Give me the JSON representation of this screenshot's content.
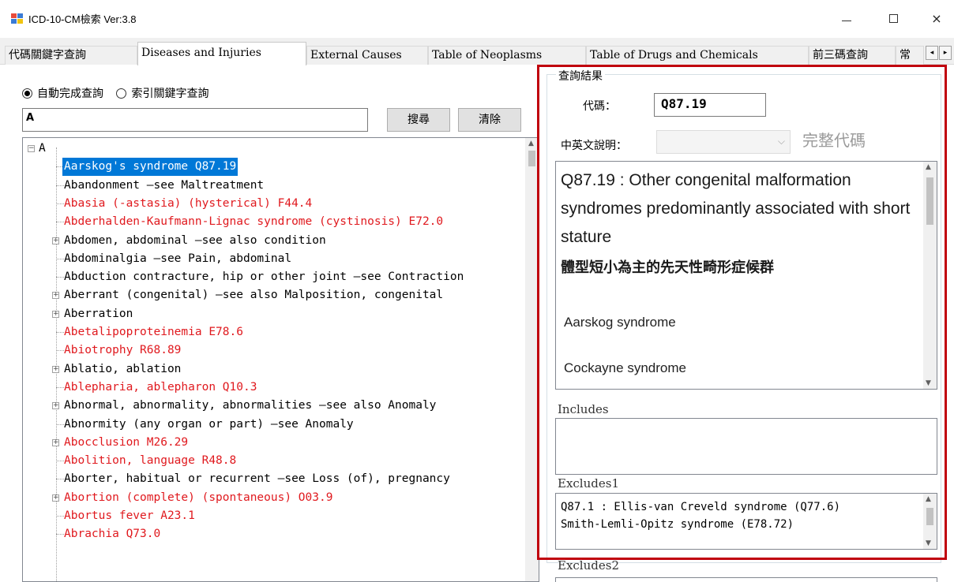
{
  "window": {
    "title": "ICD-10-CM檢索  Ver:3.8",
    "icon": "app-grid-icon",
    "controls": {
      "minimize": "minimize-icon",
      "maximize": "maximize-icon",
      "close": "×"
    }
  },
  "tabs": [
    {
      "label": "代碼關鍵字查詢",
      "active": false
    },
    {
      "label": "Diseases and Injuries",
      "active": true
    },
    {
      "label": "External Causes",
      "active": false
    },
    {
      "label": "Table of Neoplasms",
      "active": false
    },
    {
      "label": "Table of Drugs and Chemicals",
      "active": false
    },
    {
      "label": "前三碼查詢",
      "active": false
    },
    {
      "label": "常",
      "active": false
    }
  ],
  "tab_scroll": {
    "left": "◂",
    "right": "▸"
  },
  "search": {
    "mode_autocomplete": "自動完成查詢",
    "mode_index": "索引關鍵字查詢",
    "selected_mode": "autocomplete",
    "value": "A",
    "search_button": "搜尋",
    "clear_button": "清除"
  },
  "tree": {
    "root": "A",
    "items": [
      {
        "text": "Aarskog's syndrome  Q87.19",
        "color": "selected",
        "expandable": false
      },
      {
        "text": "Abandonment  —see Maltreatment",
        "color": "black",
        "expandable": false
      },
      {
        "text": "Abasia (-astasia) (hysterical) F44.4",
        "color": "red",
        "expandable": false
      },
      {
        "text": "Abderhalden-Kaufmann-Lignac syndrome (cystinosis) E72.0",
        "color": "red",
        "expandable": false
      },
      {
        "text": "Abdomen, abdominal  —see also condition",
        "color": "black",
        "expandable": true
      },
      {
        "text": "Abdominalgia  —see Pain, abdominal",
        "color": "black",
        "expandable": false
      },
      {
        "text": "Abduction contracture, hip or other joint  —see Contraction",
        "color": "black",
        "expandable": false
      },
      {
        "text": "Aberrant (congenital) —see also Malposition, congenital",
        "color": "black",
        "expandable": true
      },
      {
        "text": "Aberration",
        "color": "black",
        "expandable": true
      },
      {
        "text": "Abetalipoproteinemia  E78.6",
        "color": "red",
        "expandable": false
      },
      {
        "text": "Abiotrophy  R68.89",
        "color": "red",
        "expandable": false
      },
      {
        "text": "Ablatio, ablation",
        "color": "black",
        "expandable": true
      },
      {
        "text": "Ablepharia, ablepharon  Q10.3",
        "color": "red",
        "expandable": false
      },
      {
        "text": "Abnormal, abnormality, abnormalities  —see also Anomaly",
        "color": "black",
        "expandable": true
      },
      {
        "text": "Abnormity (any organ or part) —see Anomaly",
        "color": "black",
        "expandable": false
      },
      {
        "text": "Abocclusion  M26.29",
        "color": "red",
        "expandable": true
      },
      {
        "text": "Abolition, language  R48.8",
        "color": "red",
        "expandable": false
      },
      {
        "text": "Aborter, habitual or recurrent  —see Loss (of), pregnancy",
        "color": "black",
        "expandable": false
      },
      {
        "text": "Abortion (complete) (spontaneous) O03.9",
        "color": "red",
        "expandable": true
      },
      {
        "text": "Abortus fever  A23.1",
        "color": "red",
        "expandable": false
      },
      {
        "text": "Abrachia  Q73.0",
        "color": "red",
        "expandable": false
      }
    ]
  },
  "result": {
    "group_title": "查詢結果",
    "code_label": "代碼：",
    "code_value": "Q87.19",
    "desc_label": "中英文說明：",
    "full_code_label": "完整代碼",
    "description_en": "Q87.19 : Other congenital malformation syndromes predominantly associated with short stature",
    "description_zh": "體型短小為主的先天性畸形症候群",
    "synonyms": [
      "Aarskog syndrome",
      "Cockayne syndrome"
    ],
    "includes_label": "Includes",
    "includes_text": "",
    "excludes1_label": "Excludes1",
    "excludes1_lines": [
      "Q87.1 : Ellis-van Creveld syndrome (Q77.6)",
      "Smith-Lemli-Opitz syndrome (E78.72)"
    ],
    "excludes2_label": "Excludes2"
  },
  "colors": {
    "highlight_frame": "#c0000d",
    "red_entry": "#e0191e",
    "selection": "#0078d7"
  }
}
